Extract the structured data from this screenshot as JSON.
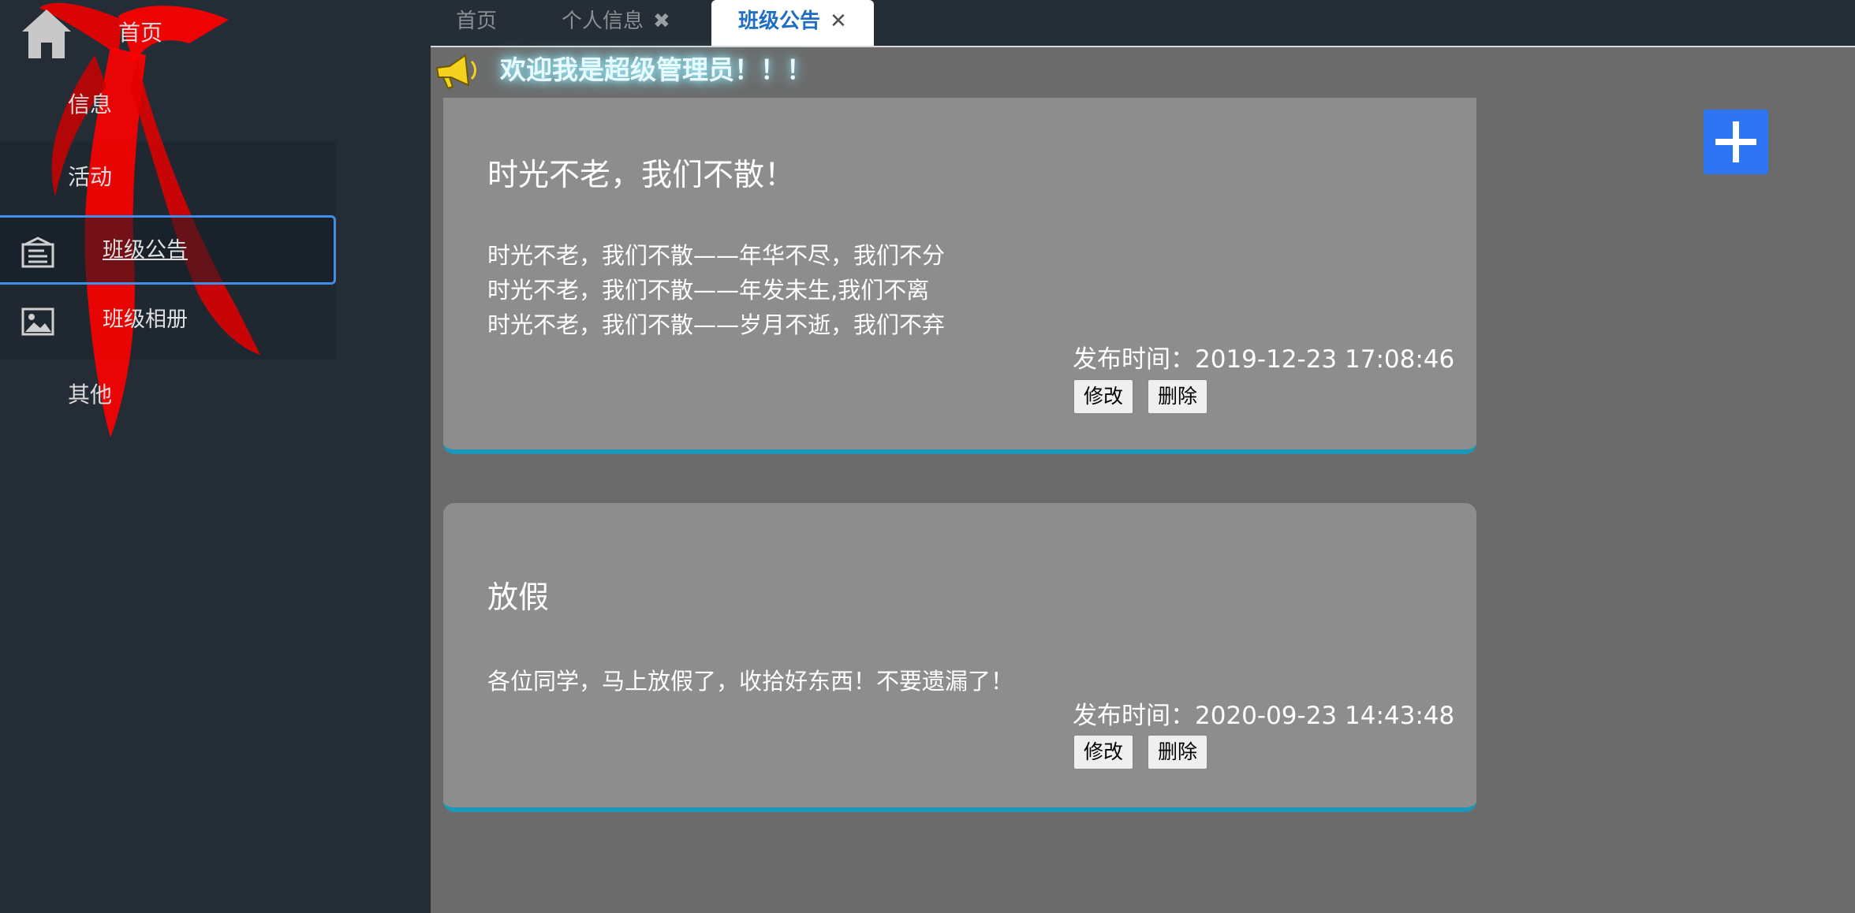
{
  "sidebar": {
    "home_label": "首页",
    "info_label": "信息",
    "activity_label": "活动",
    "items": [
      {
        "label": "班级公告",
        "icon": "notice-board-icon"
      },
      {
        "label": "班级相册",
        "icon": "image-icon"
      }
    ],
    "other_label": "其他"
  },
  "tabs": [
    {
      "label": "首页"
    },
    {
      "label": "个人信息",
      "close": "✖"
    },
    {
      "label": "班级公告",
      "close": "✕"
    }
  ],
  "welcome": "欢迎我是超级管理员！！！",
  "add_button_icon": "plus-icon",
  "announcements": [
    {
      "title": "时光不老，我们不散！",
      "lines": [
        "时光不老，我们不散——年华不尽，我们不分",
        "时光不老，我们不散——年发未生,我们不离",
        "时光不老，我们不散——岁月不逝，我们不弃"
      ],
      "time": "发布时间：2019-12-23 17:08:46",
      "edit_label": "修改",
      "delete_label": "删除"
    },
    {
      "title": "放假",
      "lines": [
        "各位同学，马上放假了，收拾好东西！不要遗漏了！"
      ],
      "time": "发布时间：2020-09-23 14:43:48",
      "edit_label": "修改",
      "delete_label": "删除"
    }
  ],
  "colors": {
    "sidebar_bg": "#242d36",
    "content_bg": "#6b6b6b",
    "card_bg": "#8d8d8d",
    "card_accent": "#1b98b8",
    "add_button": "#2d75f5",
    "active_border": "#3f8fe8"
  }
}
